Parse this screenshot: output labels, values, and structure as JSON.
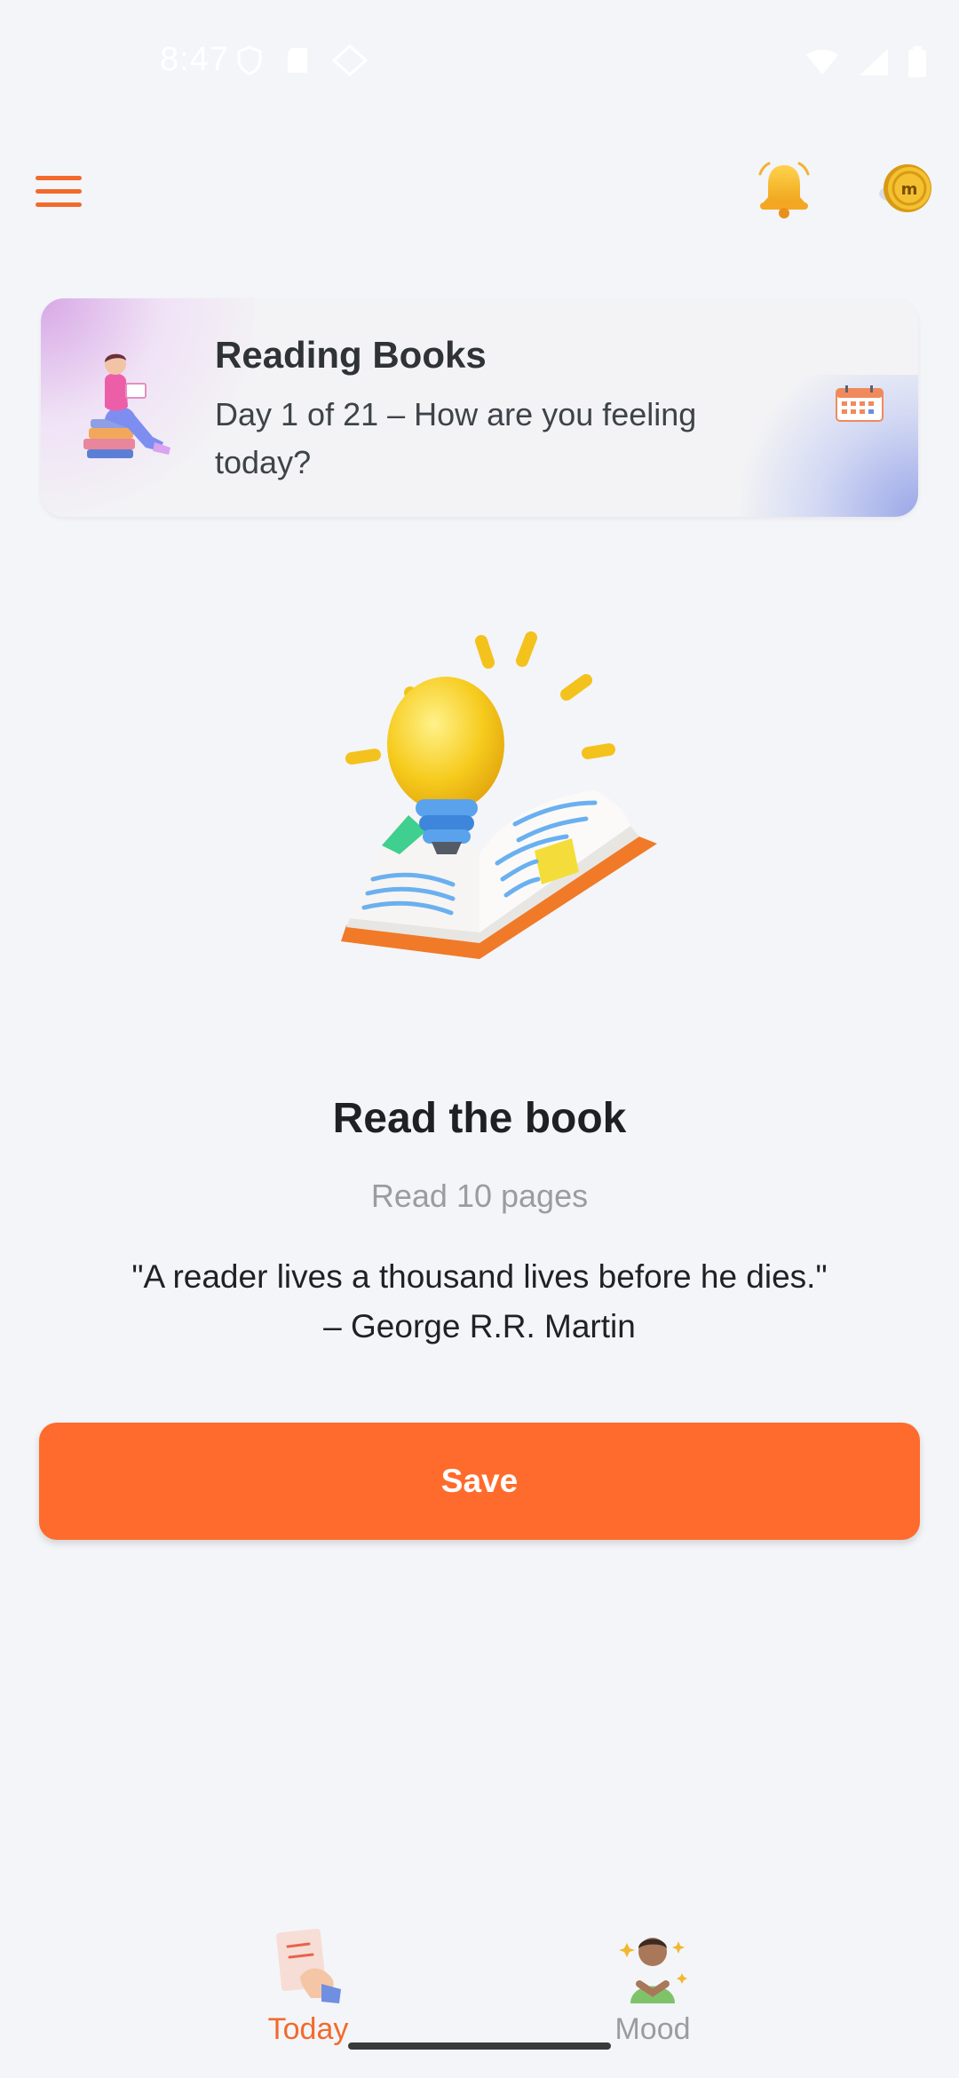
{
  "status_bar": {
    "time": "8:47"
  },
  "top_bar": {
    "menu_icon": "hamburger-menu-icon",
    "bell_icon": "bell-icon",
    "coin_icon": "coin-icon",
    "accent": "#f26a2c"
  },
  "card": {
    "title": "Reading Books",
    "subtitle": "Day 1 of 21 – How are you feeling today?"
  },
  "task": {
    "title": "Read the book",
    "subtitle": "Read 10 pages",
    "quote_line1": "\"A reader lives a thousand lives before he dies.\"",
    "quote_line2": "– George R.R. Martin"
  },
  "actions": {
    "save_label": "Save",
    "save_color": "#ff6b2c"
  },
  "bottom_nav": {
    "items": [
      {
        "label": "Today",
        "icon": "today-icon",
        "active": true,
        "color": "#f26a2c"
      },
      {
        "label": "Mood",
        "icon": "mood-icon",
        "active": false,
        "color": "#9a9ca1"
      }
    ]
  }
}
